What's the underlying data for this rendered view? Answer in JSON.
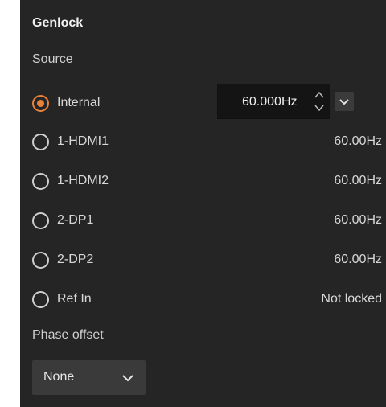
{
  "panel": {
    "title": "Genlock",
    "source_label": "Source",
    "phase_label": "Phase offset"
  },
  "sources": [
    {
      "label": "Internal",
      "value": "",
      "selected": true
    },
    {
      "label": "1-HDMI1",
      "value": "60.00Hz",
      "selected": false
    },
    {
      "label": "1-HDMI2",
      "value": "60.00Hz",
      "selected": false
    },
    {
      "label": "2-DP1",
      "value": "60.00Hz",
      "selected": false
    },
    {
      "label": "2-DP2",
      "value": "60.00Hz",
      "selected": false
    },
    {
      "label": "Ref In",
      "value": "Not locked",
      "selected": false
    }
  ],
  "internal_rate": {
    "value": "60.000Hz"
  },
  "phase_offset": {
    "value": "None"
  },
  "colors": {
    "accent": "#e8823a",
    "panel_bg": "#252525"
  }
}
